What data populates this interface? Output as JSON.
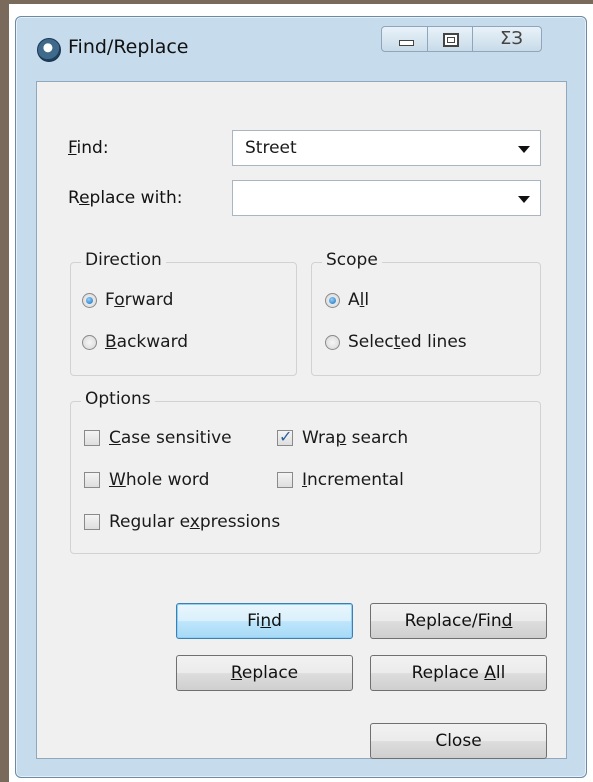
{
  "window": {
    "title": "Find/Replace"
  },
  "controls": {
    "minimize_icon": "minimize-icon",
    "maximize_icon": "maximize-icon",
    "close_glyph": "ΣЗ"
  },
  "find": {
    "label_key": "F",
    "label_rest": "ind:",
    "value": "Street"
  },
  "replace": {
    "label_pre": "R",
    "label_key": "e",
    "label_rest": "place with:",
    "value": ""
  },
  "direction": {
    "title": "Direction",
    "forward": {
      "pre": "F",
      "key": "o",
      "rest": "rward",
      "selected": true
    },
    "backward": {
      "key": "B",
      "rest": "ackward",
      "selected": false
    }
  },
  "scope": {
    "title": "Scope",
    "all": {
      "pre": "A",
      "key": "l",
      "rest": "l",
      "selected": true
    },
    "selected_lines": {
      "pre": "Selec",
      "key": "t",
      "rest": "ed lines",
      "selected": false
    }
  },
  "options": {
    "title": "Options",
    "case_sensitive": {
      "key": "C",
      "rest": "ase sensitive",
      "checked": false
    },
    "wrap_search": {
      "pre": "Wra",
      "key": "p",
      "rest": " search",
      "checked": true
    },
    "whole_word": {
      "key": "W",
      "rest": "hole word",
      "checked": false
    },
    "incremental": {
      "key": "I",
      "rest": "ncremental",
      "checked": false
    },
    "regular_expressions": {
      "pre": "Regular e",
      "key": "x",
      "rest": "pressions",
      "checked": false
    }
  },
  "buttons": {
    "find": {
      "pre": "Fi",
      "key": "n",
      "rest": "d"
    },
    "replace_find": {
      "pre": "Replace/Fin",
      "key": "d",
      "rest": ""
    },
    "replace": {
      "key": "R",
      "rest": "eplace"
    },
    "replace_all": {
      "pre": "Replace ",
      "key": "A",
      "rest": "ll"
    },
    "close": {
      "label": "Close"
    }
  },
  "colors": {
    "accent": "#1a6fb8",
    "window_frame": "#c6dbeb",
    "client_bg": "#f0f0f0"
  }
}
